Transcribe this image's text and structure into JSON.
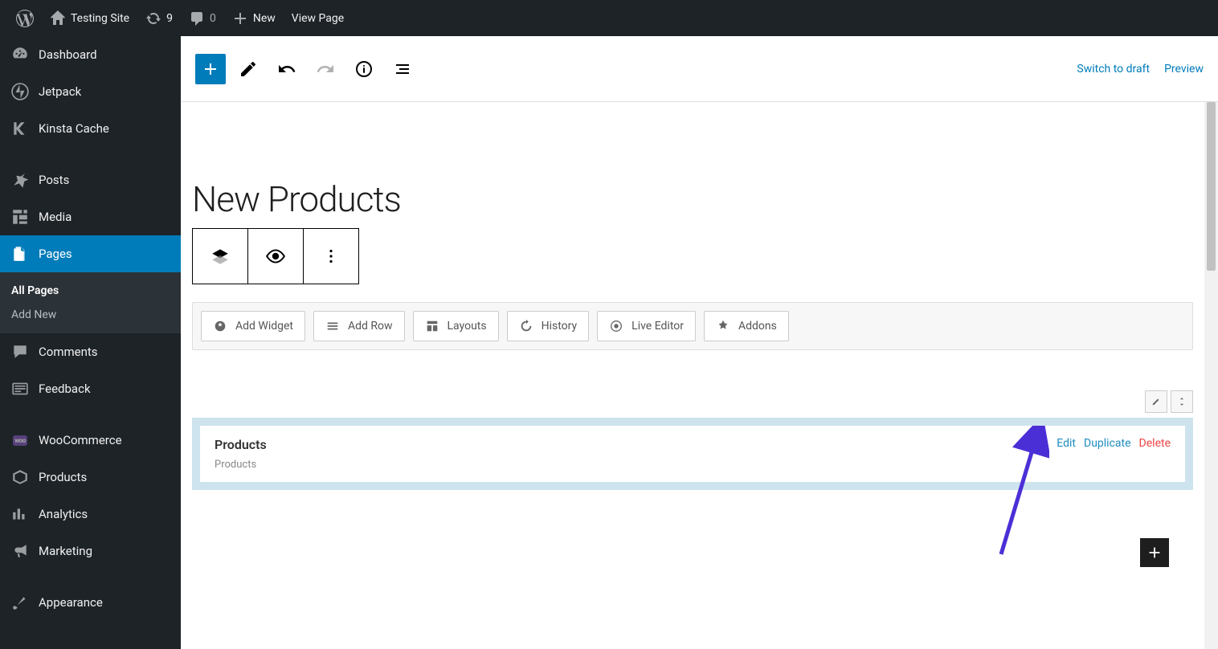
{
  "adminBar": {
    "siteName": "Testing Site",
    "updates": "9",
    "commentsCount": "0",
    "newLabel": "New",
    "viewPage": "View Page"
  },
  "sidebar": {
    "items": [
      {
        "label": "Dashboard"
      },
      {
        "label": "Jetpack"
      },
      {
        "label": "Kinsta Cache"
      },
      {
        "label": "Posts"
      },
      {
        "label": "Media"
      },
      {
        "label": "Pages"
      },
      {
        "label": "Comments"
      },
      {
        "label": "Feedback"
      },
      {
        "label": "WooCommerce"
      },
      {
        "label": "Products"
      },
      {
        "label": "Analytics"
      },
      {
        "label": "Marketing"
      },
      {
        "label": "Appearance"
      }
    ],
    "sub": {
      "allPages": "All Pages",
      "addNew": "Add New"
    }
  },
  "editorTop": {
    "switchDraft": "Switch to draft",
    "preview": "Preview"
  },
  "page": {
    "title": "New Products"
  },
  "builderToolbar": {
    "addWidget": "Add Widget",
    "addRow": "Add Row",
    "layouts": "Layouts",
    "history": "History",
    "liveEditor": "Live Editor",
    "addons": "Addons"
  },
  "widget": {
    "title": "Products",
    "subtitle": "Products",
    "edit": "Edit",
    "duplicate": "Duplicate",
    "delete": "Delete"
  }
}
